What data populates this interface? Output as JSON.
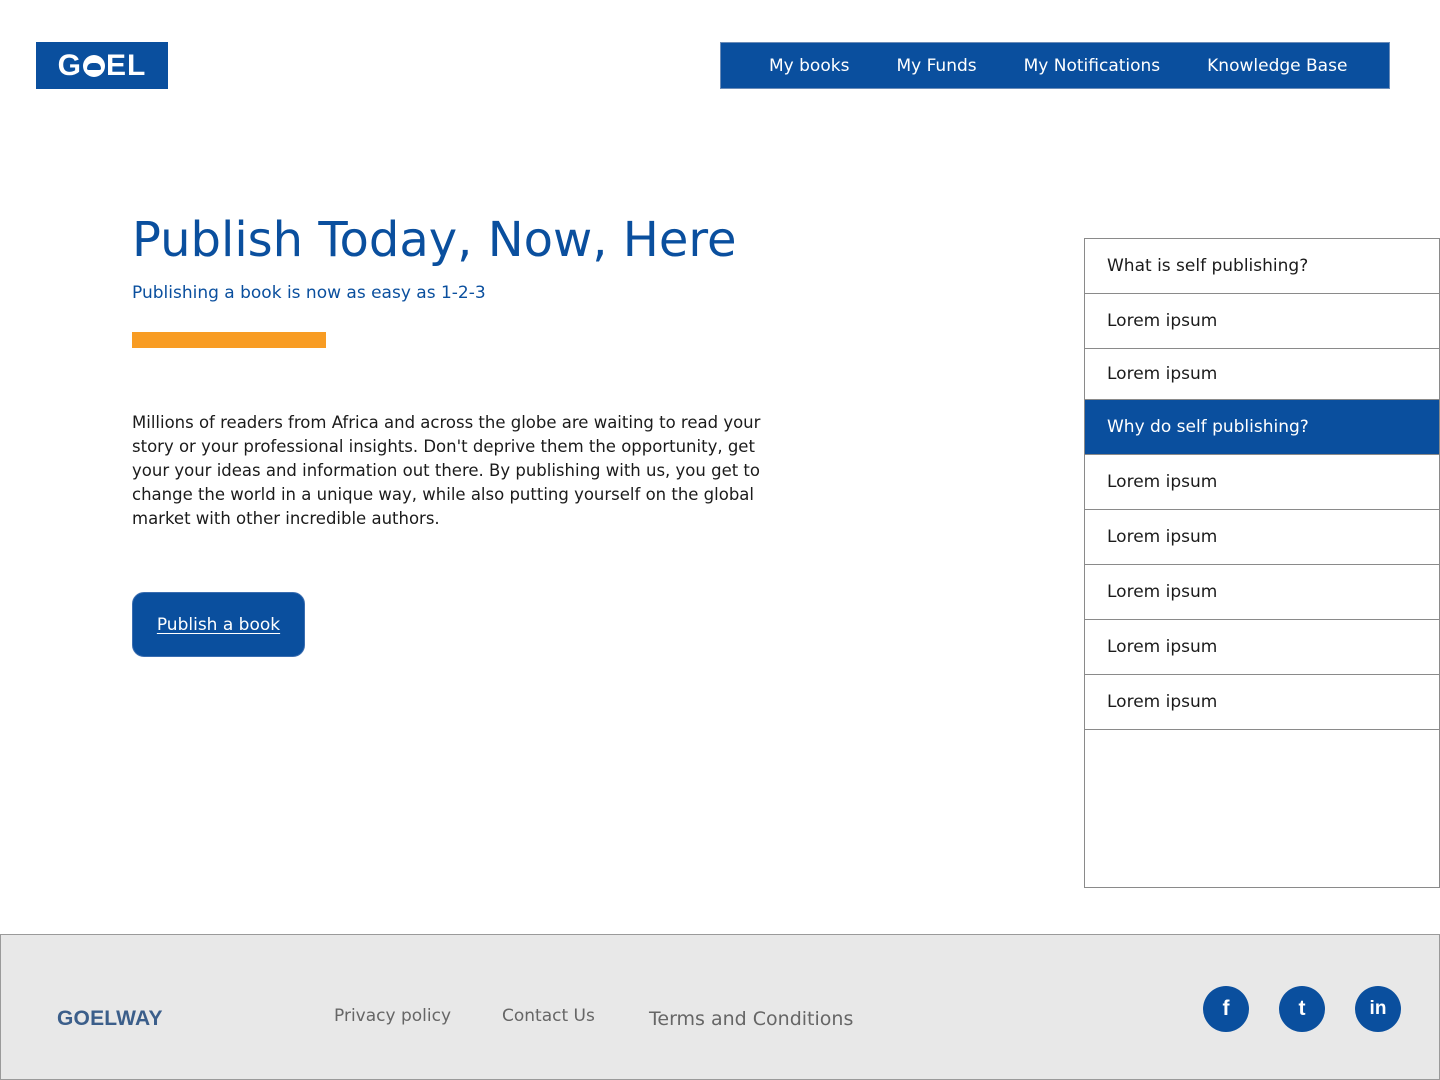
{
  "header": {
    "logo_text_left": "G",
    "logo_text_right": "EL",
    "nav": [
      {
        "label": "My books"
      },
      {
        "label": "My Funds"
      },
      {
        "label": "My Notifications"
      },
      {
        "label": "Knowledge Base"
      }
    ]
  },
  "hero": {
    "title": "Publish Today, Now, Here",
    "subtitle": "Publishing a book is now as easy as 1-2-3",
    "body": "Millions of readers from Africa and across the globe are waiting to read your story or your professional insights. Don't deprive them the opportunity, get your your ideas and information out there. By publishing with us, you get to change the world in a unique way, while also putting yourself on the global market with other incredible authors.",
    "cta_label": "Publish a book"
  },
  "faq": {
    "items": [
      {
        "label": "What is self publishing?",
        "active": false
      },
      {
        "label": "Lorem ipsum",
        "active": false
      },
      {
        "label": "Lorem ipsum",
        "active": false
      },
      {
        "label": "Why do self publishing?",
        "active": true
      },
      {
        "label": "Lorem ipsum",
        "active": false
      },
      {
        "label": "Lorem ipsum",
        "active": false
      },
      {
        "label": "Lorem ipsum",
        "active": false
      },
      {
        "label": "Lorem ipsum",
        "active": false
      },
      {
        "label": "Lorem ipsum",
        "active": false
      }
    ]
  },
  "footer": {
    "brand": "GOELWAY",
    "links": {
      "privacy": "Privacy policy",
      "contact": "Contact Us",
      "terms": "Terms and Conditions"
    },
    "social": {
      "facebook": "f",
      "twitter": "t",
      "linkedin": "in"
    }
  },
  "colors": {
    "primary": "#0a4f9e",
    "accent": "#f89c23",
    "footer_bg": "#e8e8e8"
  },
  "icons": [
    "logo-icon",
    "facebook-icon",
    "twitter-icon",
    "linkedin-icon"
  ]
}
